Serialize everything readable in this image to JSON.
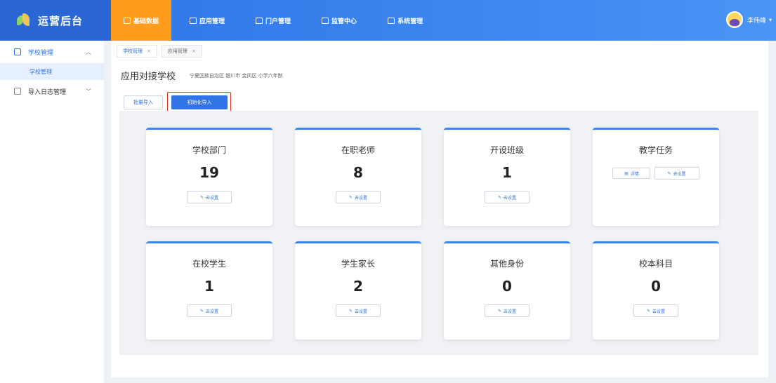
{
  "brand": {
    "name": "运营后台",
    "logo_icon": "leaf-logo-icon"
  },
  "nav": [
    {
      "label": "基础数据",
      "icon": "grid-icon",
      "active": true
    },
    {
      "label": "应用管理",
      "icon": "apps-icon",
      "active": false
    },
    {
      "label": "门户管理",
      "icon": "portal-icon",
      "active": false
    },
    {
      "label": "监管中心",
      "icon": "home-icon",
      "active": false
    },
    {
      "label": "系统管理",
      "icon": "settings-icon",
      "active": false
    }
  ],
  "user": {
    "name": "李伟峰",
    "caret": "▾"
  },
  "sidebar": {
    "groups": [
      {
        "label": "学校管理",
        "icon": "school-icon",
        "chevron": "︿",
        "open": true,
        "children": [
          {
            "label": "学校管理"
          }
        ]
      },
      {
        "label": "导入日志管理",
        "icon": "log-icon",
        "chevron": "﹀",
        "open": false
      }
    ]
  },
  "tabs": [
    {
      "label": "学校管理",
      "close": "×"
    },
    {
      "label": "应用管理",
      "close": "×"
    }
  ],
  "page": {
    "title": "应用对接学校",
    "subtitle": "宁夏回族自治区 银川市 金凤区 小学六年制"
  },
  "actions": {
    "batch_import": "批量导入",
    "init_import": "初始化导入"
  },
  "cards": [
    {
      "title": "学校部门",
      "value": "19",
      "setup": "去设置"
    },
    {
      "title": "在职老师",
      "value": "8",
      "setup": "去设置"
    },
    {
      "title": "开设班级",
      "value": "1",
      "setup": "去设置"
    },
    {
      "title": "教学任务",
      "detail": "详情",
      "setup": "去设置"
    },
    {
      "title": "在校学生",
      "value": "1",
      "setup": "去设置"
    },
    {
      "title": "学生家长",
      "value": "2",
      "setup": "去设置"
    },
    {
      "title": "其他身份",
      "value": "0",
      "setup": "去设置"
    },
    {
      "title": "校本科目",
      "value": "0",
      "setup": "去设置"
    }
  ],
  "icons": {
    "setup": "✎",
    "detail": "▤"
  },
  "colors": {
    "primary": "#2f73e4",
    "accent_orange": "#ff9c1e",
    "highlight_red": "#e0302a"
  }
}
